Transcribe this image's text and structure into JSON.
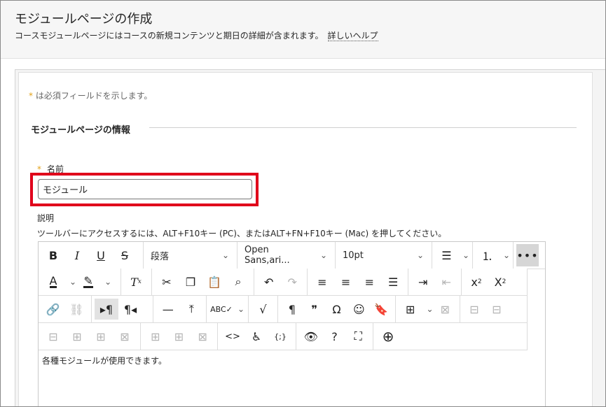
{
  "header": {
    "title": "モジュールページの作成",
    "subtitle": "コースモジュールページにはコースの新規コンテンツと期日の詳細が含まれます。",
    "help_link": "詳しいヘルプ"
  },
  "form": {
    "required_star": "*",
    "required_note": "は必須フィールドを示します。",
    "section_title": "モジュールページの情報",
    "name_label": "名前",
    "name_value": "モジュール",
    "description_label": "説明",
    "toolbar_hint": "ツールバーにアクセスするには、ALT+F10キー (PC)、またはALT+FN+F10キー (Mac) を押してください。"
  },
  "editor": {
    "paragraph_select": "段落",
    "font_select": "Open Sans,ari...",
    "size_select": "10pt",
    "more_label": "•••",
    "content": "各種モジュールが使用できます。"
  },
  "colors": {
    "highlight": "#e0001b",
    "required_star": "#e3a21a"
  }
}
